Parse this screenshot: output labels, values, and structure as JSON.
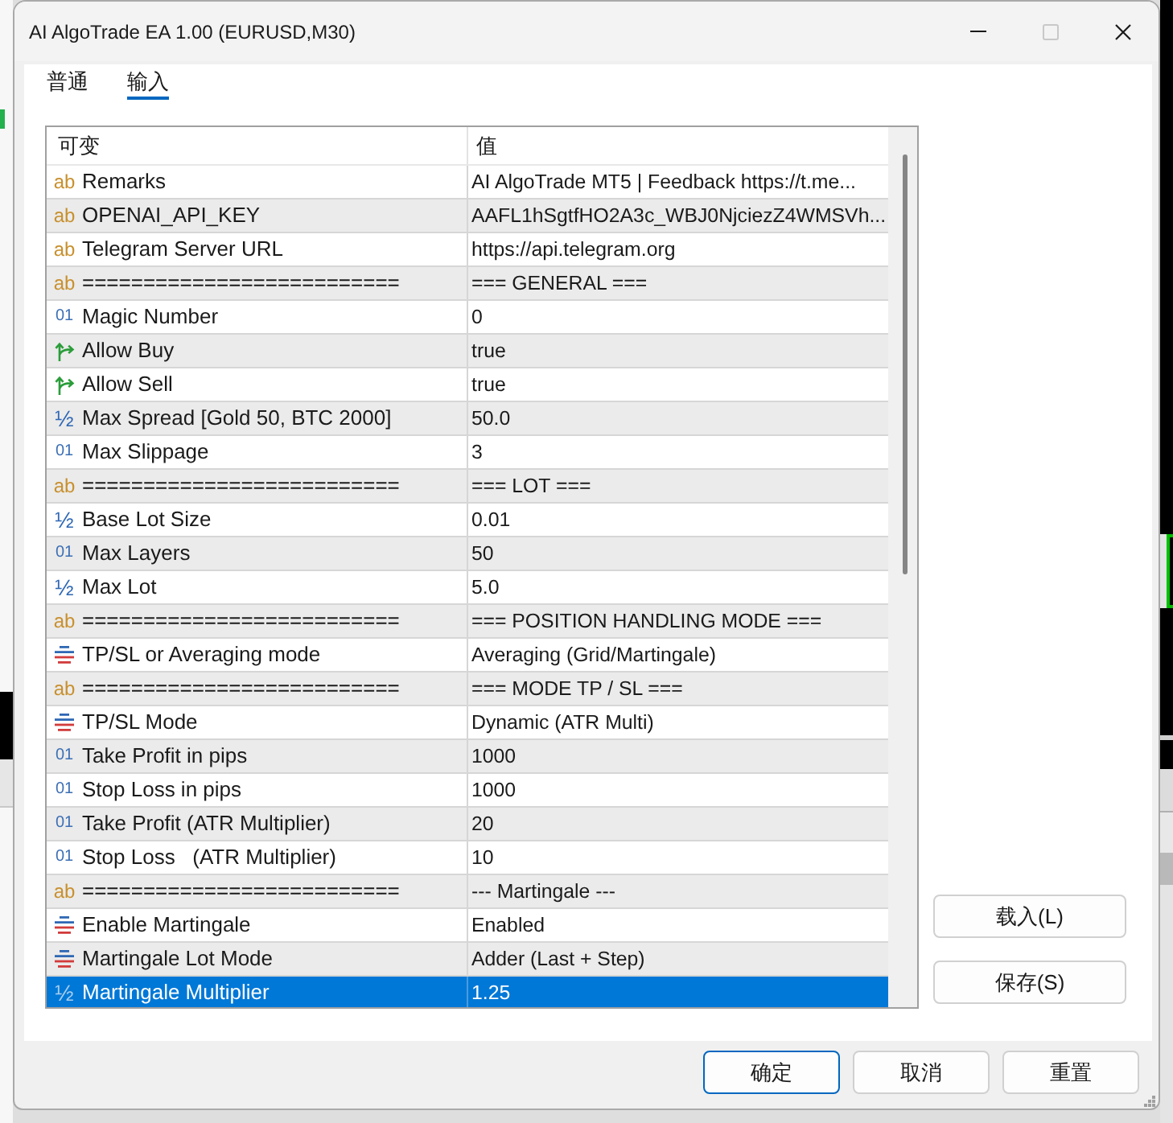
{
  "window": {
    "title": "AI AlgoTrade EA 1.00 (EURUSD,M30)",
    "maximize_disabled": true
  },
  "tabs": [
    {
      "label": "普通",
      "selected": false
    },
    {
      "label": "输入",
      "selected": true
    }
  ],
  "table": {
    "columns": [
      "可变",
      "值"
    ],
    "rows": [
      {
        "kind": "string",
        "icon": "ab",
        "name": "Remarks",
        "value": "AI AlgoTrade MT5 | Feedback https://t.me...",
        "selected": false
      },
      {
        "kind": "string",
        "icon": "ab",
        "name": "OPENAI_API_KEY",
        "value": "AAFL1hSgtfHO2A3c_WBJ0NjciezZ4WMSVh...",
        "selected": false
      },
      {
        "kind": "string",
        "icon": "ab",
        "name": "Telegram Server URL",
        "value": "https://api.telegram.org",
        "selected": false
      },
      {
        "kind": "string",
        "icon": "ab",
        "name": "==========================",
        "value": "=== GENERAL ===",
        "selected": false
      },
      {
        "kind": "int",
        "icon": "01",
        "name": "Magic Number",
        "value": "0",
        "selected": false
      },
      {
        "kind": "bool",
        "name": "Allow Buy",
        "value": "true",
        "selected": false
      },
      {
        "kind": "bool",
        "name": "Allow Sell",
        "value": "true",
        "selected": false
      },
      {
        "kind": "double",
        "icon": "½",
        "name": "Max Spread [Gold 50, BTC 2000]",
        "value": "50.0",
        "selected": false
      },
      {
        "kind": "int",
        "icon": "01",
        "name": "Max Slippage",
        "value": "3",
        "selected": false
      },
      {
        "kind": "string",
        "icon": "ab",
        "name": "==========================",
        "value": "=== LOT ===",
        "selected": false
      },
      {
        "kind": "double",
        "icon": "½",
        "name": "Base Lot Size",
        "value": "0.01",
        "selected": false
      },
      {
        "kind": "int",
        "icon": "01",
        "name": "Max Layers",
        "value": "50",
        "selected": false
      },
      {
        "kind": "double",
        "icon": "½",
        "name": "Max Lot",
        "value": "5.0",
        "selected": false
      },
      {
        "kind": "string",
        "icon": "ab",
        "name": "==========================",
        "value": "=== POSITION HANDLING MODE ===",
        "selected": false
      },
      {
        "kind": "enum",
        "name": "TP/SL or Averaging mode",
        "value": "Averaging (Grid/Martingale)",
        "selected": false
      },
      {
        "kind": "string",
        "icon": "ab",
        "name": "==========================",
        "value": "=== MODE TP / SL ===",
        "selected": false
      },
      {
        "kind": "enum",
        "name": "TP/SL Mode",
        "value": "Dynamic (ATR Multi)",
        "selected": false
      },
      {
        "kind": "int",
        "icon": "01",
        "name": "Take Profit in pips",
        "value": "1000",
        "selected": false
      },
      {
        "kind": "int",
        "icon": "01",
        "name": "Stop Loss in pips",
        "value": "1000",
        "selected": false
      },
      {
        "kind": "int",
        "icon": "01",
        "name": "Take Profit (ATR Multiplier)",
        "value": "20",
        "selected": false
      },
      {
        "kind": "int",
        "icon": "01",
        "name": "Stop Loss   (ATR Multiplier)",
        "value": "10",
        "selected": false
      },
      {
        "kind": "string",
        "icon": "ab",
        "name": "==========================",
        "value": "--- Martingale ---",
        "selected": false
      },
      {
        "kind": "enum",
        "name": "Enable Martingale",
        "value": "Enabled",
        "selected": false
      },
      {
        "kind": "enum",
        "name": "Martingale Lot Mode",
        "value": "Adder (Last + Step)",
        "selected": false
      },
      {
        "kind": "double",
        "icon": "½",
        "name": "Martingale Multiplier",
        "value": "1.25",
        "selected": true
      }
    ]
  },
  "side_buttons": [
    "载入(L)",
    "保存(S)"
  ],
  "footer_buttons": [
    {
      "label": "确定",
      "default": true
    },
    {
      "label": "取消",
      "default": false
    },
    {
      "label": "重置",
      "default": false
    }
  ]
}
